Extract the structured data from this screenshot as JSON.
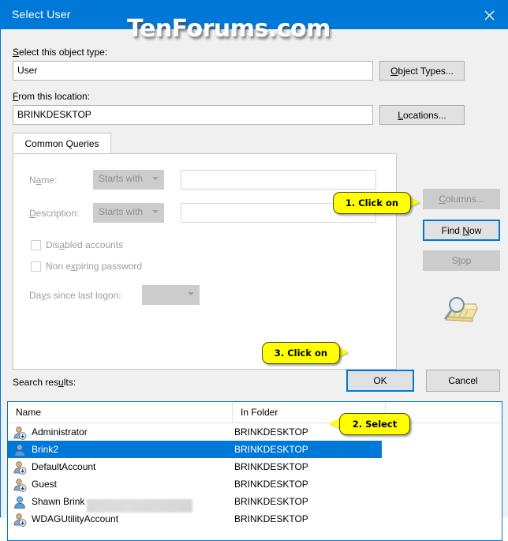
{
  "window": {
    "title": "Select User",
    "close_icon": "close-icon",
    "accent_color": "#0078d7"
  },
  "watermark": {
    "text": "TenForums.com"
  },
  "object_type": {
    "label": "Select this object type:",
    "value": "User",
    "button": "Object Types..."
  },
  "location": {
    "label": "From this location:",
    "value": "BRINKDESKTOP",
    "button": "Locations..."
  },
  "tabs": [
    {
      "label": "Common Queries",
      "selected": true
    }
  ],
  "query": {
    "name_label": "Name:",
    "name_condition": "Starts with",
    "name_value": "",
    "description_label": "Description:",
    "description_condition": "Starts with",
    "description_value": "",
    "disabled_accounts_label": "Disabled accounts",
    "disabled_accounts_checked": false,
    "non_expiring_password_label": "Non expiring password",
    "non_expiring_password_checked": false,
    "days_label": "Days since last logon:",
    "days_value": "",
    "find_icon": "magnifier-folder-icon"
  },
  "side_buttons": {
    "columns": "Columns...",
    "columns_enabled": false,
    "find_now": "Find Now",
    "find_now_focused": true,
    "stop": "Stop",
    "stop_enabled": false
  },
  "dialog_buttons": {
    "ok": "OK",
    "ok_focused": true,
    "cancel": "Cancel"
  },
  "results": {
    "label": "Search results:",
    "columns": [
      "Name",
      "In Folder"
    ],
    "rows": [
      {
        "name": "Administrator",
        "folder": "BRINKDESKTOP",
        "icon": "user-arrow-icon",
        "selected": false,
        "redacted": false
      },
      {
        "name": "Brink2",
        "folder": "BRINKDESKTOP",
        "icon": "user-icon",
        "selected": true,
        "redacted": false
      },
      {
        "name": "DefaultAccount",
        "folder": "BRINKDESKTOP",
        "icon": "user-arrow-icon",
        "selected": false,
        "redacted": false
      },
      {
        "name": "Guest",
        "folder": "BRINKDESKTOP",
        "icon": "user-arrow-icon",
        "selected": false,
        "redacted": false
      },
      {
        "name": "Shawn Brink",
        "folder": "BRINKDESKTOP",
        "icon": "user-icon",
        "selected": false,
        "redacted": true
      },
      {
        "name": "WDAGUtilityAccount",
        "folder": "BRINKDESKTOP",
        "icon": "user-arrow-icon",
        "selected": false,
        "redacted": false
      }
    ]
  },
  "callouts": [
    {
      "text": "1. Click on",
      "direction": "right"
    },
    {
      "text": "2. Select",
      "direction": "left"
    },
    {
      "text": "3. Click on",
      "direction": "right"
    }
  ]
}
